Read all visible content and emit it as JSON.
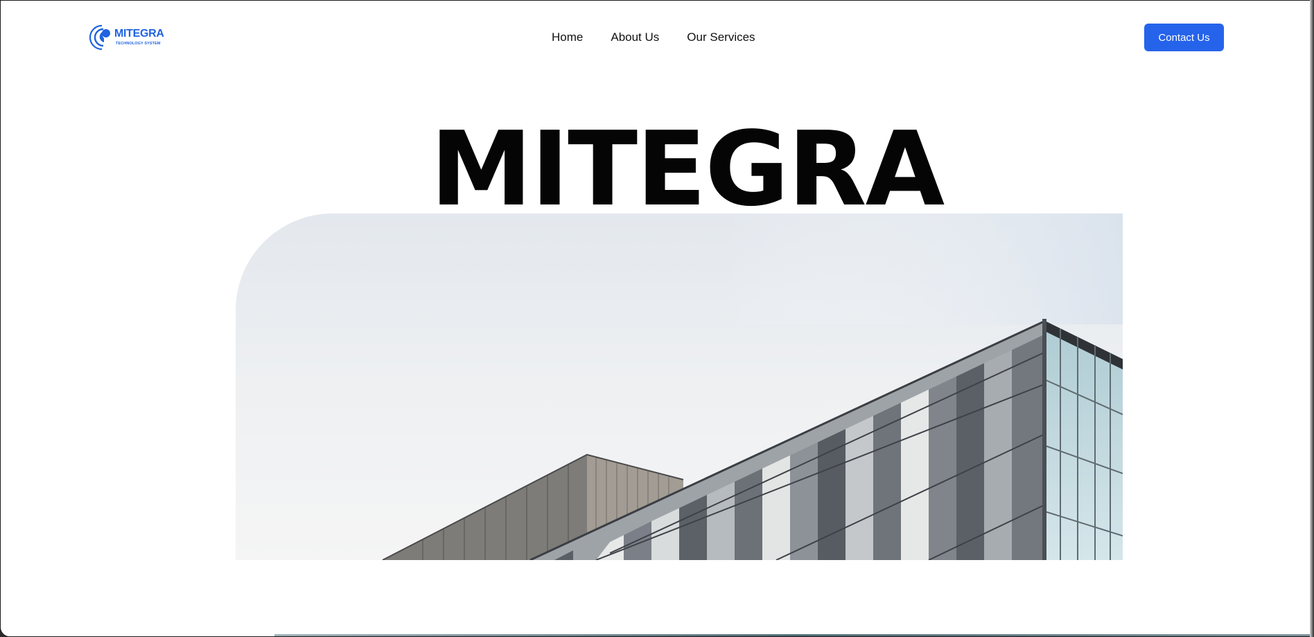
{
  "brand": {
    "name": "MITEGRA",
    "tagline": "TECHNOLOGY SYSTEM",
    "color": "#1f63e0"
  },
  "nav": {
    "items": [
      {
        "label": "Home"
      },
      {
        "label": "About Us"
      },
      {
        "label": "Our Services"
      }
    ]
  },
  "header": {
    "cta_label": "Contact Us",
    "cta_color": "#2563eb"
  },
  "hero": {
    "title": "MITEGRA",
    "image_subject": "modern-glass-office-building"
  },
  "icons": {
    "logo": "mitegra-logo-icon"
  }
}
